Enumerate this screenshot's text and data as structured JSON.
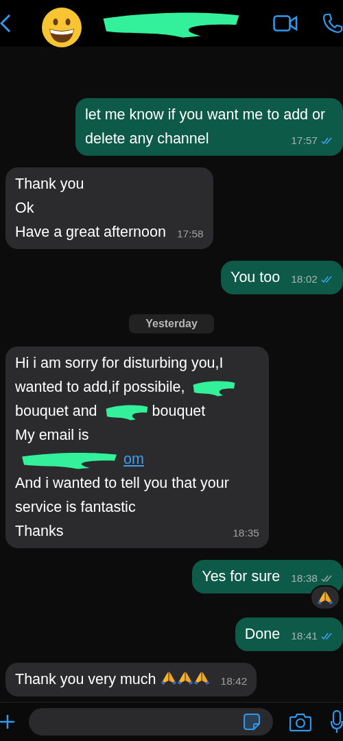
{
  "header": {
    "title_parts": [
      {
        "kind": "redacted"
      }
    ]
  },
  "messages": [
    {
      "kind": "sent",
      "paragraphs": [
        [
          {
            "kind": "text",
            "text": "let me know if you want me to add or delete any channel"
          }
        ]
      ],
      "time": "17:57",
      "read": true
    },
    {
      "kind": "received",
      "paragraphs": [
        [
          {
            "kind": "text",
            "text": "Thank you"
          }
        ],
        [
          {
            "kind": "text",
            "text": "Ok"
          }
        ],
        [
          {
            "kind": "text",
            "text": "Have a great afternoon"
          }
        ]
      ],
      "time": "17:58"
    },
    {
      "kind": "sent",
      "paragraphs": [
        [
          {
            "kind": "text",
            "text": "You too"
          }
        ]
      ],
      "time": "18:02",
      "read": true
    },
    {
      "kind": "date",
      "text": "Yesterday"
    },
    {
      "kind": "received",
      "paragraphs": [
        [
          {
            "kind": "text",
            "text": "Hi i am sorry for disturbing you,I wanted to add,if possibile,"
          },
          {
            "kind": "redacted"
          },
          {
            "kind": "text",
            "text": "bouquet and"
          },
          {
            "kind": "redacted"
          },
          {
            "kind": "text",
            "text": "bouquet"
          }
        ],
        [
          {
            "kind": "text",
            "text": "My email is"
          }
        ],
        [
          {
            "kind": "link",
            "parts": [
              {
                "kind": "redacted"
              },
              {
                "kind": "text",
                "text": "om"
              }
            ]
          }
        ],
        [
          {
            "kind": "text",
            "text": "And i wanted to tell you that your service is fantastic"
          }
        ],
        [
          {
            "kind": "text",
            "text": "Thanks"
          }
        ]
      ],
      "time": "18:35"
    },
    {
      "kind": "sent",
      "paragraphs": [
        [
          {
            "kind": "text",
            "text": "Yes for sure"
          }
        ]
      ],
      "time": "18:38",
      "read": false,
      "reactions": [
        {
          "kind": "emoji"
        }
      ]
    },
    {
      "kind": "sent",
      "paragraphs": [
        [
          {
            "kind": "text",
            "text": "Done"
          }
        ]
      ],
      "time": "18:41",
      "read": true
    },
    {
      "kind": "received",
      "paragraphs": [
        [
          {
            "kind": "text",
            "text": "Thank you very much"
          },
          {
            "kind": "emoji"
          },
          {
            "kind": "emoji"
          },
          {
            "kind": "emoji"
          }
        ]
      ],
      "time": "18:42"
    }
  ]
}
